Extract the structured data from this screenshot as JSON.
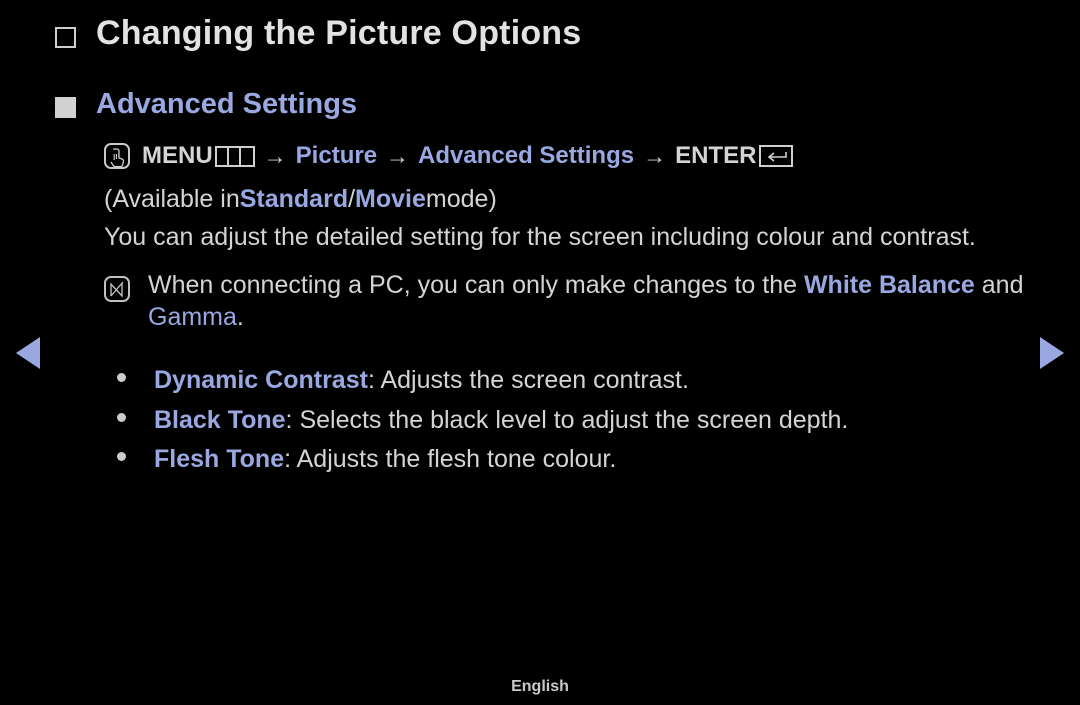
{
  "page": {
    "title": "Changing the Picture Options",
    "subtitle": "Advanced Settings",
    "footer_language": "English",
    "colors": {
      "background": "#000000",
      "text": "#d4d4d4",
      "accent_blue": "#9aa8e2",
      "bullet_square": "#d2d2d2"
    }
  },
  "menu_path": {
    "press_icon": "press-hand-icon",
    "menu_label": "MENU",
    "menu_box_glyph": "menu-grid-glyph",
    "arrow1": "→",
    "item1": "Picture",
    "arrow2": "→",
    "item2": "Advanced Settings",
    "arrow3": "→",
    "enter_label": "ENTER",
    "enter_glyph": "return-arrow-glyph"
  },
  "availability": {
    "prefix": "(Available in ",
    "mode1": "Standard",
    "separator": " / ",
    "mode2": "Movie",
    "suffix": " mode)"
  },
  "description": "You can adjust the detailed setting for the screen including colour and contrast.",
  "note": {
    "icon": "note-n-icon",
    "text_before": "When connecting a PC, you can only make changes to the ",
    "highlight1": "White Balance",
    "text_middle": "and ",
    "highlight2": "Gamma",
    "text_after": "."
  },
  "options": [
    {
      "term": "Dynamic Contrast",
      "separator": ": ",
      "description": "Adjusts the screen contrast."
    },
    {
      "term": "Black Tone",
      "separator": ": ",
      "description": "Selects the black level to adjust the screen depth."
    },
    {
      "term": "Flesh Tone",
      "separator": ": ",
      "description": "Adjusts the flesh tone colour."
    }
  ],
  "navigation": {
    "prev_label": "previous-page",
    "next_label": "next-page"
  }
}
